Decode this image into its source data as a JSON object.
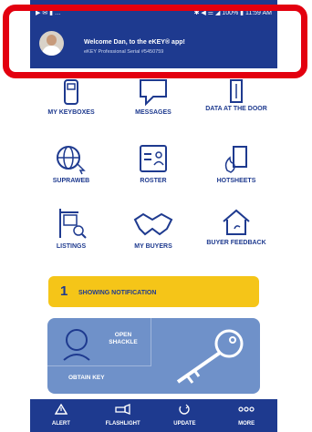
{
  "status_bar": {
    "left_icons": "▶ ✉ ▮ …",
    "right_text": "✱ ◀ ☰ ◢ 100% ▮ 11:59 AM"
  },
  "header": {
    "welcome": "Welcome Dan, to the eKEY® app!",
    "serial": "eKEY Professional Serial #5450759"
  },
  "grid": [
    {
      "label": "MY KEYBOXES",
      "icon": "keybox-icon"
    },
    {
      "label": "MESSAGES",
      "icon": "chat-bubble-icon"
    },
    {
      "label": "DATA AT THE DOOR",
      "icon": "door-icon"
    },
    {
      "label": "SUPRAWEB",
      "icon": "globe-icon"
    },
    {
      "label": "ROSTER",
      "icon": "roster-card-icon"
    },
    {
      "label": "HOTSHEETS",
      "icon": "hotsheet-flame-icon"
    },
    {
      "label": "LISTINGS",
      "icon": "listing-sign-icon"
    },
    {
      "label": "MY BUYERS",
      "icon": "handshake-icon"
    },
    {
      "label": "BUYER FEEDBACK",
      "icon": "house-feedback-icon"
    }
  ],
  "notification": {
    "count": "1",
    "text": "SHOWING NOTIFICATION",
    "color": "#f5c518"
  },
  "key_panel": {
    "open_shackle": "OPEN SHACKLE",
    "obtain_key": "OBTAIN KEY"
  },
  "tabs": [
    {
      "label": "ALERT",
      "icon": "alert-triangle-icon"
    },
    {
      "label": "FLASHLIGHT",
      "icon": "flashlight-icon"
    },
    {
      "label": "UPDATE",
      "icon": "update-icon"
    },
    {
      "label": "MORE",
      "icon": "more-dots-icon"
    }
  ],
  "colors": {
    "brand_blue": "#1e3a8f",
    "highlight_red": "#e3000f",
    "panel_blue": "#6f91c9"
  }
}
